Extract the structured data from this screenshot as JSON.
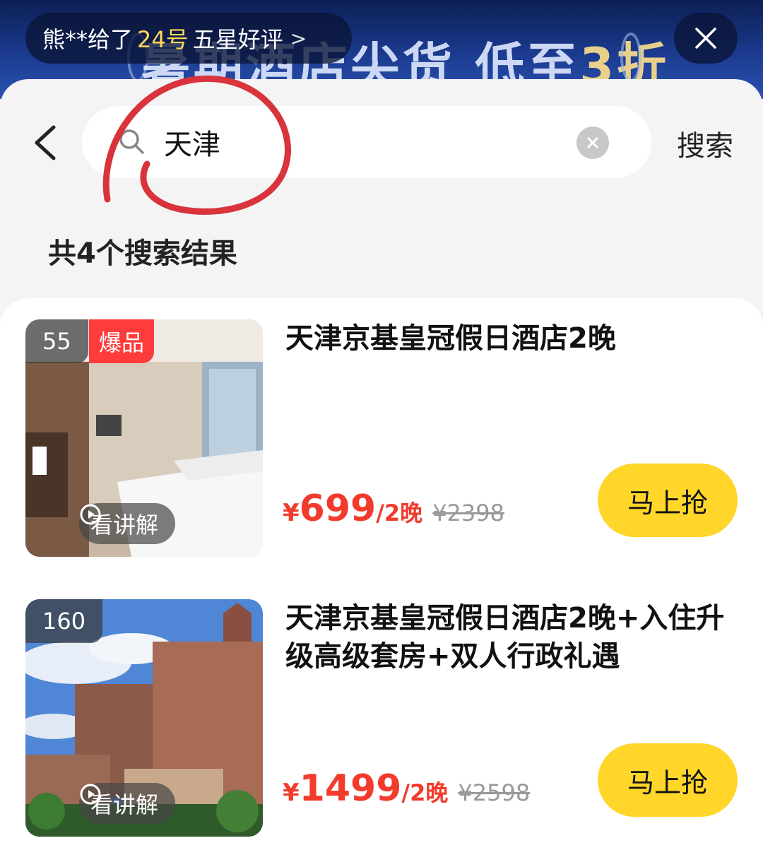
{
  "banner": {
    "headline_a": "暑期酒店尖货",
    "headline_b": "低至",
    "headline_c": "3折"
  },
  "review_ticker": {
    "user": "熊**给了",
    "room": "24号",
    "text": "五星好评",
    "chevron": ">"
  },
  "search": {
    "query": "天津",
    "placeholder": "",
    "submit_label": "搜索"
  },
  "result_count": "共4个搜索结果",
  "colors": {
    "price_red": "#f23b2c",
    "buy_yellow": "#ffd629",
    "hot_red": "#ff3b3b",
    "annotation_red": "#d9333b"
  },
  "results": [
    {
      "views": "55",
      "tag": "爆品",
      "video_label": "看讲解",
      "title": "天津京基皇冠假日酒店2晚",
      "currency": "¥",
      "price": "699",
      "per": "/2晚",
      "original_price": "¥2398",
      "buy_label": "马上抢"
    },
    {
      "views": "160",
      "tag": "",
      "video_label": "看讲解",
      "title": "天津京基皇冠假日酒店2晚+入住升级高级套房+双人行政礼遇",
      "currency": "¥",
      "price": "1499",
      "per": "/2晚",
      "original_price": "¥2598",
      "buy_label": "马上抢"
    }
  ]
}
